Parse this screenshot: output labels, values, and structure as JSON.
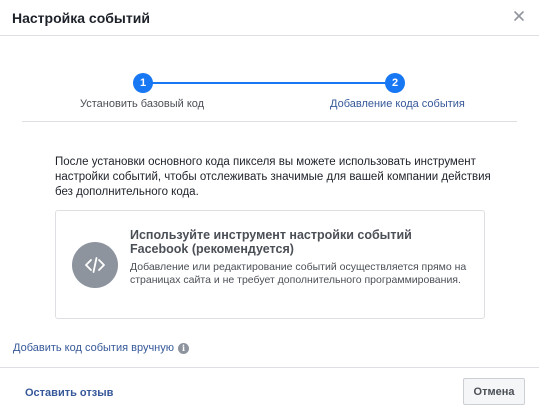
{
  "dialog": {
    "title": "Настройка событий"
  },
  "stepper": {
    "steps": [
      {
        "number": "1",
        "label": "Установить базовый код",
        "state": "done"
      },
      {
        "number": "2",
        "label": "Добавление кода события",
        "state": "active"
      }
    ]
  },
  "main": {
    "intro_text": "После установки основного кода пикселя вы можете использовать инструмент настройки событий, чтобы отслеживать значимые для вашей компании действия без дополнительного кода.",
    "option_card": {
      "icon": "code-icon",
      "title": "Используйте инструмент настройки событий Facebook (рекомендуется)",
      "description": "Добавление или редактирование событий осуществляется прямо на страницах сайта и не требует дополнительного программирования."
    },
    "manual_link": {
      "label": "Добавить код события вручную",
      "icon": "info-icon"
    }
  },
  "footer": {
    "feedback_label": "Оставить отзыв",
    "cancel_label": "Отмена"
  },
  "colors": {
    "accent": "#1877f2",
    "link": "#365899",
    "icon_gray": "#8d949e",
    "border": "#dddfe2"
  }
}
